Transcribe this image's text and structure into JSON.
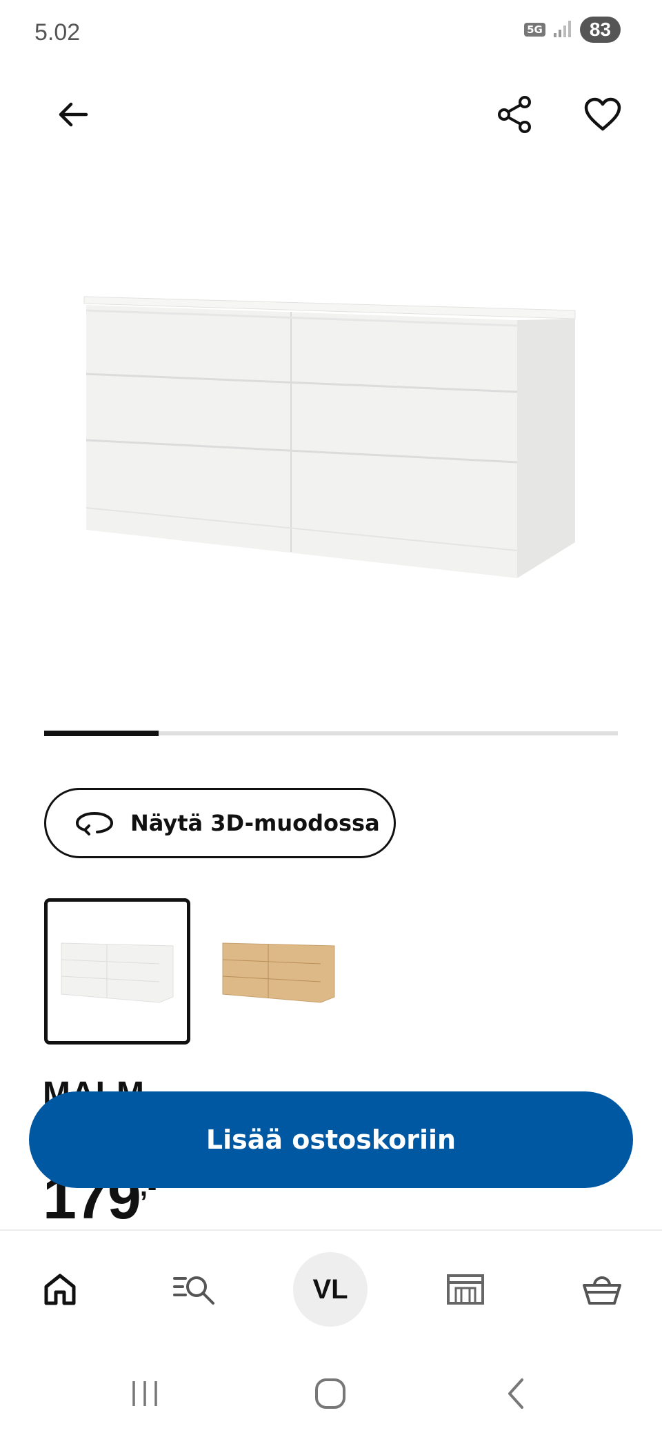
{
  "status_bar": {
    "time": "5.02",
    "network": "5G",
    "battery": "83"
  },
  "top_bar": {
    "icons": [
      "back-arrow-icon",
      "share-icon",
      "heart-icon"
    ]
  },
  "carousel": {
    "current": 1,
    "total": 5,
    "progress": 0.2
  },
  "view_3d": {
    "label": "Näytä 3D-muodossa",
    "icon": "rotate-3d-icon"
  },
  "variants": [
    {
      "color_name": "white",
      "hex": "#f2f2f0",
      "selected": true
    },
    {
      "color_name": "oak",
      "hex": "#ddb987",
      "selected": false
    }
  ],
  "product": {
    "name": "MALM",
    "price": "179",
    "price_suffix": ",-"
  },
  "cart_button": {
    "label": "Lisää ostoskoriin",
    "color": "#0058a3"
  },
  "bottom_nav": {
    "items": [
      "home-icon",
      "search-icon",
      "account-avatar",
      "store-icon",
      "basket-icon"
    ],
    "avatar_initials": "VL"
  },
  "system_nav": {
    "items": [
      "recent-apps-icon",
      "home-circle-icon",
      "back-chevron-icon"
    ]
  }
}
